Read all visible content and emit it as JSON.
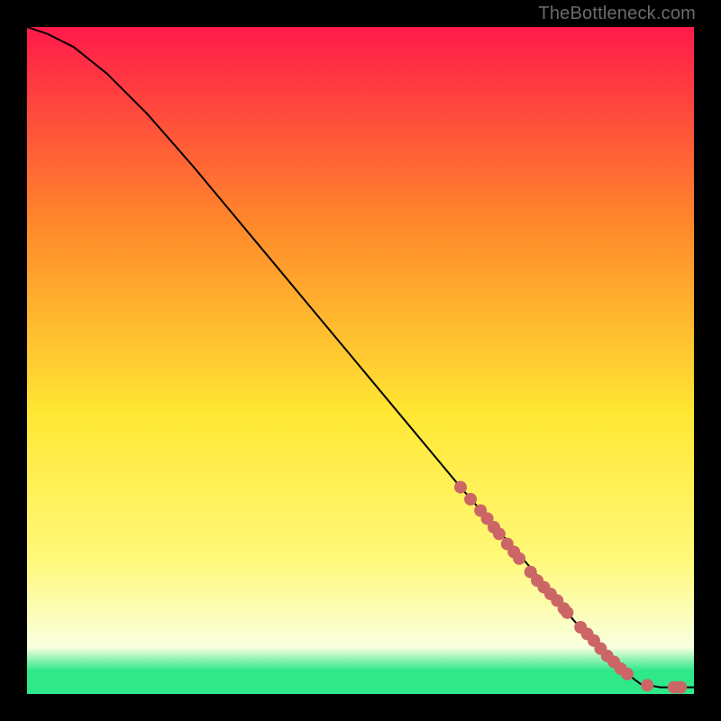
{
  "attribution": "TheBottleneck.com",
  "colors": {
    "top": "#ff1a4a",
    "mid_upper": "#ff8a2a",
    "mid": "#ffe733",
    "mid_lower": "#fff97a",
    "pale": "#f9ffe0",
    "green": "#2ee88a",
    "line": "#000000",
    "marker": "#cc6666",
    "frame": "#000000"
  },
  "chart_data": {
    "type": "line",
    "title": "",
    "xlabel": "",
    "ylabel": "",
    "xlim": [
      0,
      100
    ],
    "ylim": [
      0,
      100
    ],
    "curve": {
      "name": "bottleneck-curve",
      "x": [
        0,
        3,
        7,
        12,
        18,
        25,
        35,
        45,
        55,
        65,
        72,
        78,
        82,
        85,
        88,
        90,
        92,
        95,
        100
      ],
      "y": [
        100,
        99,
        97,
        93,
        87,
        79,
        67,
        55,
        43,
        31,
        23,
        16,
        11,
        8,
        5,
        3,
        1.5,
        1,
        1
      ]
    },
    "markers": {
      "name": "highlight-points",
      "x": [
        65,
        66.5,
        68,
        69,
        70,
        70.8,
        72,
        73,
        73.8,
        75.5,
        76.5,
        77.5,
        78.5,
        79.5,
        80.5,
        81,
        83,
        84,
        85,
        86,
        87,
        88,
        89,
        90,
        93,
        97,
        98
      ],
      "y": [
        31,
        29.2,
        27.5,
        26.3,
        25,
        24,
        22.5,
        21.3,
        20.3,
        18.3,
        17,
        16,
        15,
        14,
        12.8,
        12.2,
        10,
        9,
        8,
        6.8,
        5.7,
        4.8,
        3.8,
        3,
        1.3,
        1,
        1
      ]
    }
  }
}
